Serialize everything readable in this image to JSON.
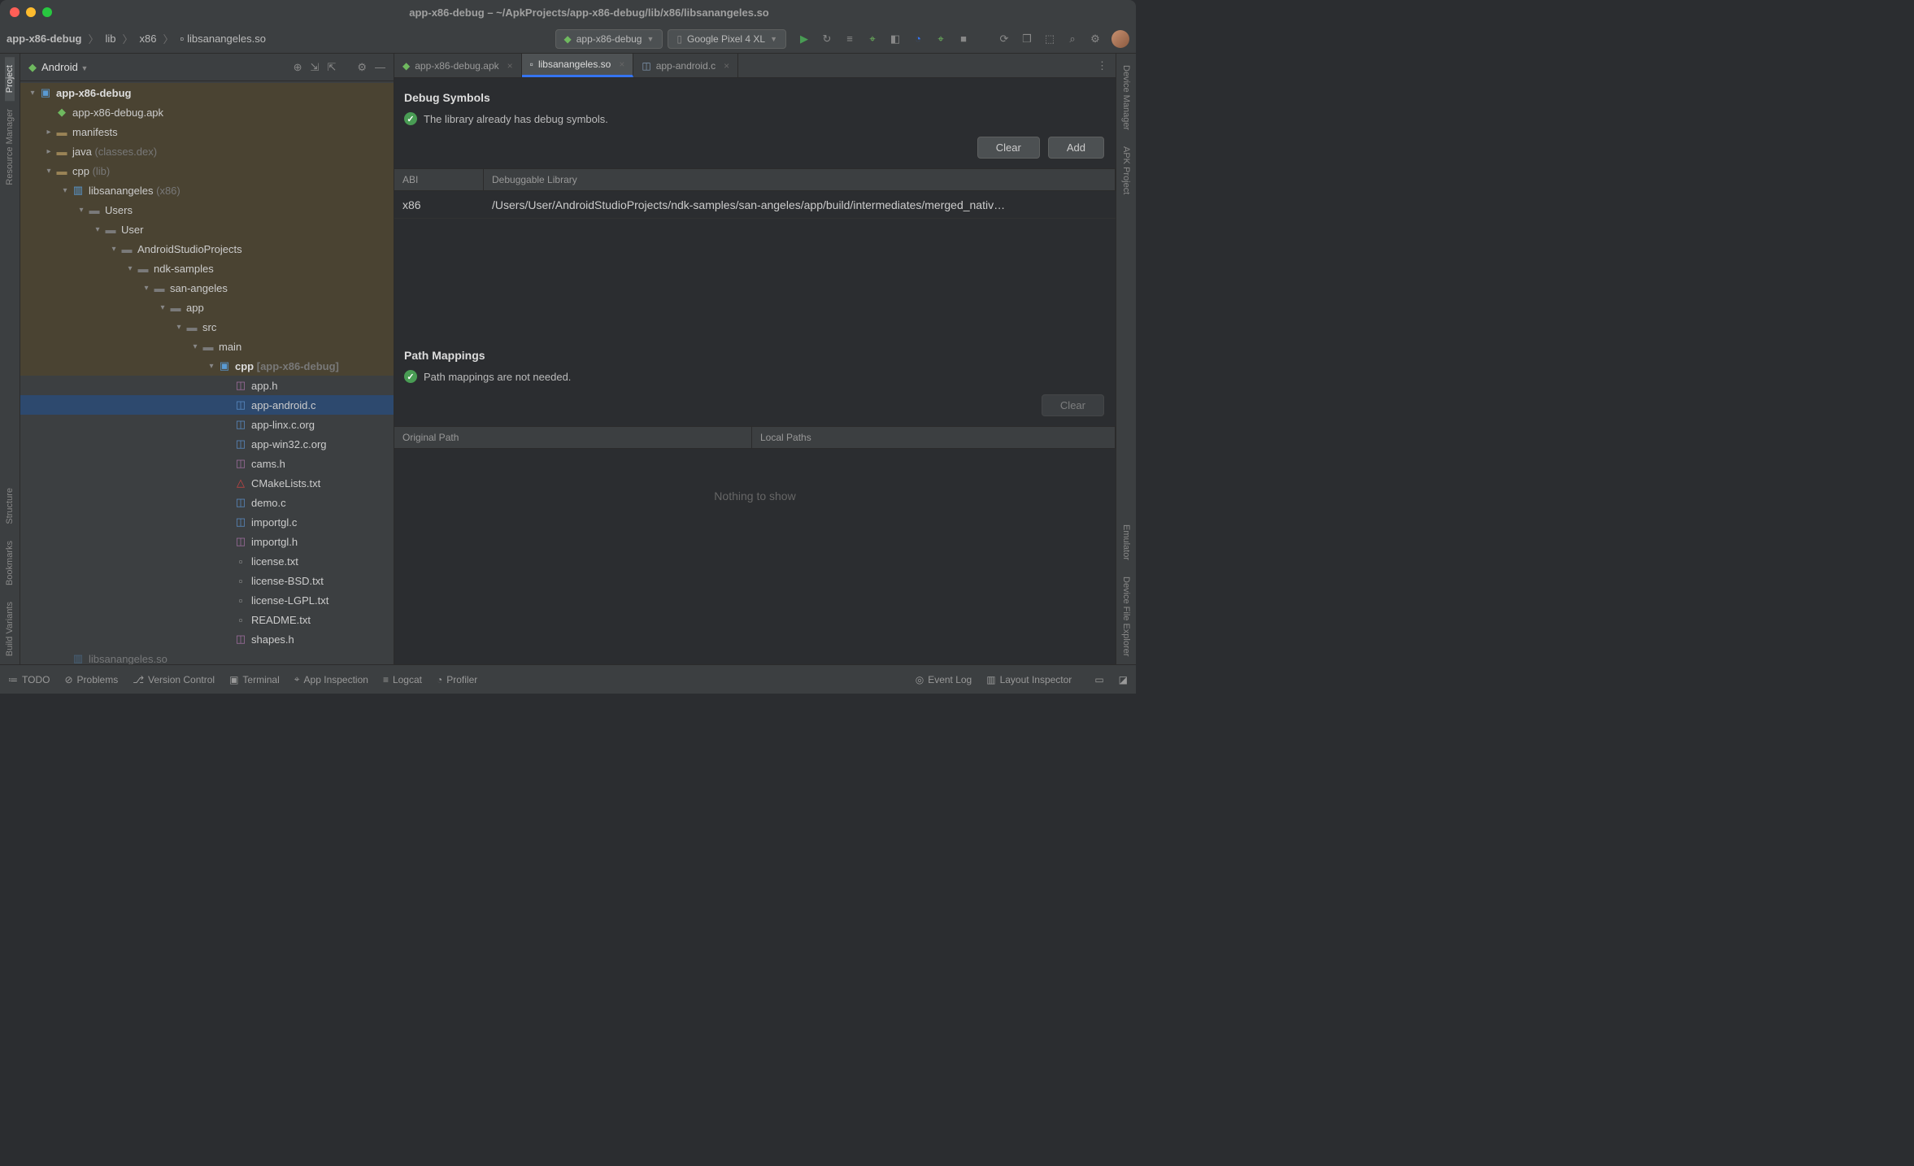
{
  "window_title": "app-x86-debug – ~/ApkProjects/app-x86-debug/lib/x86/libsanangeles.so",
  "breadcrumb": [
    "app-x86-debug",
    "lib",
    "x86",
    "libsanangeles.so"
  ],
  "run_config": "app-x86-debug",
  "device": "Google Pixel 4 XL",
  "left_rail": [
    "Project",
    "Resource Manager",
    "Structure",
    "Bookmarks",
    "Build Variants"
  ],
  "right_rail": [
    "Device Manager",
    "APK Project",
    "Emulator",
    "Device File Explorer"
  ],
  "project": {
    "scope": "Android",
    "tree": [
      {
        "depth": 0,
        "arrow": "▾",
        "icon": "module",
        "label": "app-x86-debug",
        "bold": true,
        "hl": true
      },
      {
        "depth": 1,
        "arrow": "",
        "icon": "apk",
        "label": "app-x86-debug.apk",
        "hl": true
      },
      {
        "depth": 1,
        "arrow": "▸",
        "icon": "folder",
        "label": "manifests",
        "hl": true
      },
      {
        "depth": 1,
        "arrow": "▸",
        "icon": "folder",
        "label": "java",
        "muted": "(classes.dex)",
        "hl": true
      },
      {
        "depth": 1,
        "arrow": "▾",
        "icon": "folder",
        "label": "cpp",
        "muted": "(lib)",
        "hl": true
      },
      {
        "depth": 2,
        "arrow": "▾",
        "icon": "lib",
        "label": "libsanangeles",
        "muted": "(x86)",
        "hl": true
      },
      {
        "depth": 3,
        "arrow": "▾",
        "icon": "folder-g",
        "label": "Users",
        "hl": true
      },
      {
        "depth": 4,
        "arrow": "▾",
        "icon": "folder-g",
        "label": "User",
        "hl": true
      },
      {
        "depth": 5,
        "arrow": "▾",
        "icon": "folder-g",
        "label": "AndroidStudioProjects",
        "hl": true
      },
      {
        "depth": 6,
        "arrow": "▾",
        "icon": "folder-g",
        "label": "ndk-samples",
        "hl": true
      },
      {
        "depth": 7,
        "arrow": "▾",
        "icon": "folder-g",
        "label": "san-angeles",
        "hl": true
      },
      {
        "depth": 8,
        "arrow": "▾",
        "icon": "folder-g",
        "label": "app",
        "hl": true
      },
      {
        "depth": 9,
        "arrow": "▾",
        "icon": "folder-g",
        "label": "src",
        "hl": true
      },
      {
        "depth": 10,
        "arrow": "▾",
        "icon": "folder-g",
        "label": "main",
        "hl": true
      },
      {
        "depth": 11,
        "arrow": "▾",
        "icon": "module",
        "label": "cpp",
        "muted": "[app-x86-debug]",
        "bold": true,
        "hl": true
      },
      {
        "depth": 12,
        "arrow": "",
        "icon": "h",
        "label": "app.h"
      },
      {
        "depth": 12,
        "arrow": "",
        "icon": "c",
        "label": "app-android.c",
        "selected": true
      },
      {
        "depth": 12,
        "arrow": "",
        "icon": "c",
        "label": "app-linx.c.org"
      },
      {
        "depth": 12,
        "arrow": "",
        "icon": "c",
        "label": "app-win32.c.org"
      },
      {
        "depth": 12,
        "arrow": "",
        "icon": "h",
        "label": "cams.h"
      },
      {
        "depth": 12,
        "arrow": "",
        "icon": "cmake",
        "label": "CMakeLists.txt"
      },
      {
        "depth": 12,
        "arrow": "",
        "icon": "c",
        "label": "demo.c"
      },
      {
        "depth": 12,
        "arrow": "",
        "icon": "c",
        "label": "importgl.c"
      },
      {
        "depth": 12,
        "arrow": "",
        "icon": "h",
        "label": "importgl.h"
      },
      {
        "depth": 12,
        "arrow": "",
        "icon": "txt",
        "label": "license.txt"
      },
      {
        "depth": 12,
        "arrow": "",
        "icon": "txt",
        "label": "license-BSD.txt"
      },
      {
        "depth": 12,
        "arrow": "",
        "icon": "txt",
        "label": "license-LGPL.txt"
      },
      {
        "depth": 12,
        "arrow": "",
        "icon": "txt",
        "label": "README.txt"
      },
      {
        "depth": 12,
        "arrow": "",
        "icon": "h",
        "label": "shapes.h"
      },
      {
        "depth": 2,
        "arrow": "",
        "icon": "lib",
        "label": "libsanangeles.so",
        "dim": true
      }
    ]
  },
  "tabs": [
    {
      "label": "app-x86-debug.apk",
      "icon": "apk",
      "active": false
    },
    {
      "label": "libsanangeles.so",
      "icon": "file",
      "active": true
    },
    {
      "label": "app-android.c",
      "icon": "c",
      "active": false
    }
  ],
  "debug": {
    "heading": "Debug Symbols",
    "status": "The library already has debug symbols.",
    "clear_btn": "Clear",
    "add_btn": "Add",
    "col_abi": "ABI",
    "col_lib": "Debuggable Library",
    "rows": [
      {
        "abi": "x86",
        "lib": "/Users/User/AndroidStudioProjects/ndk-samples/san-angeles/app/build/intermediates/merged_nativ…"
      }
    ]
  },
  "path": {
    "heading": "Path Mappings",
    "status": "Path mappings are not needed.",
    "clear_btn": "Clear",
    "col_orig": "Original Path",
    "col_local": "Local Paths",
    "empty": "Nothing to show"
  },
  "statusbar": {
    "left": [
      "TODO",
      "Problems",
      "Version Control",
      "Terminal",
      "App Inspection",
      "Logcat",
      "Profiler"
    ],
    "right": [
      "Event Log",
      "Layout Inspector"
    ]
  }
}
